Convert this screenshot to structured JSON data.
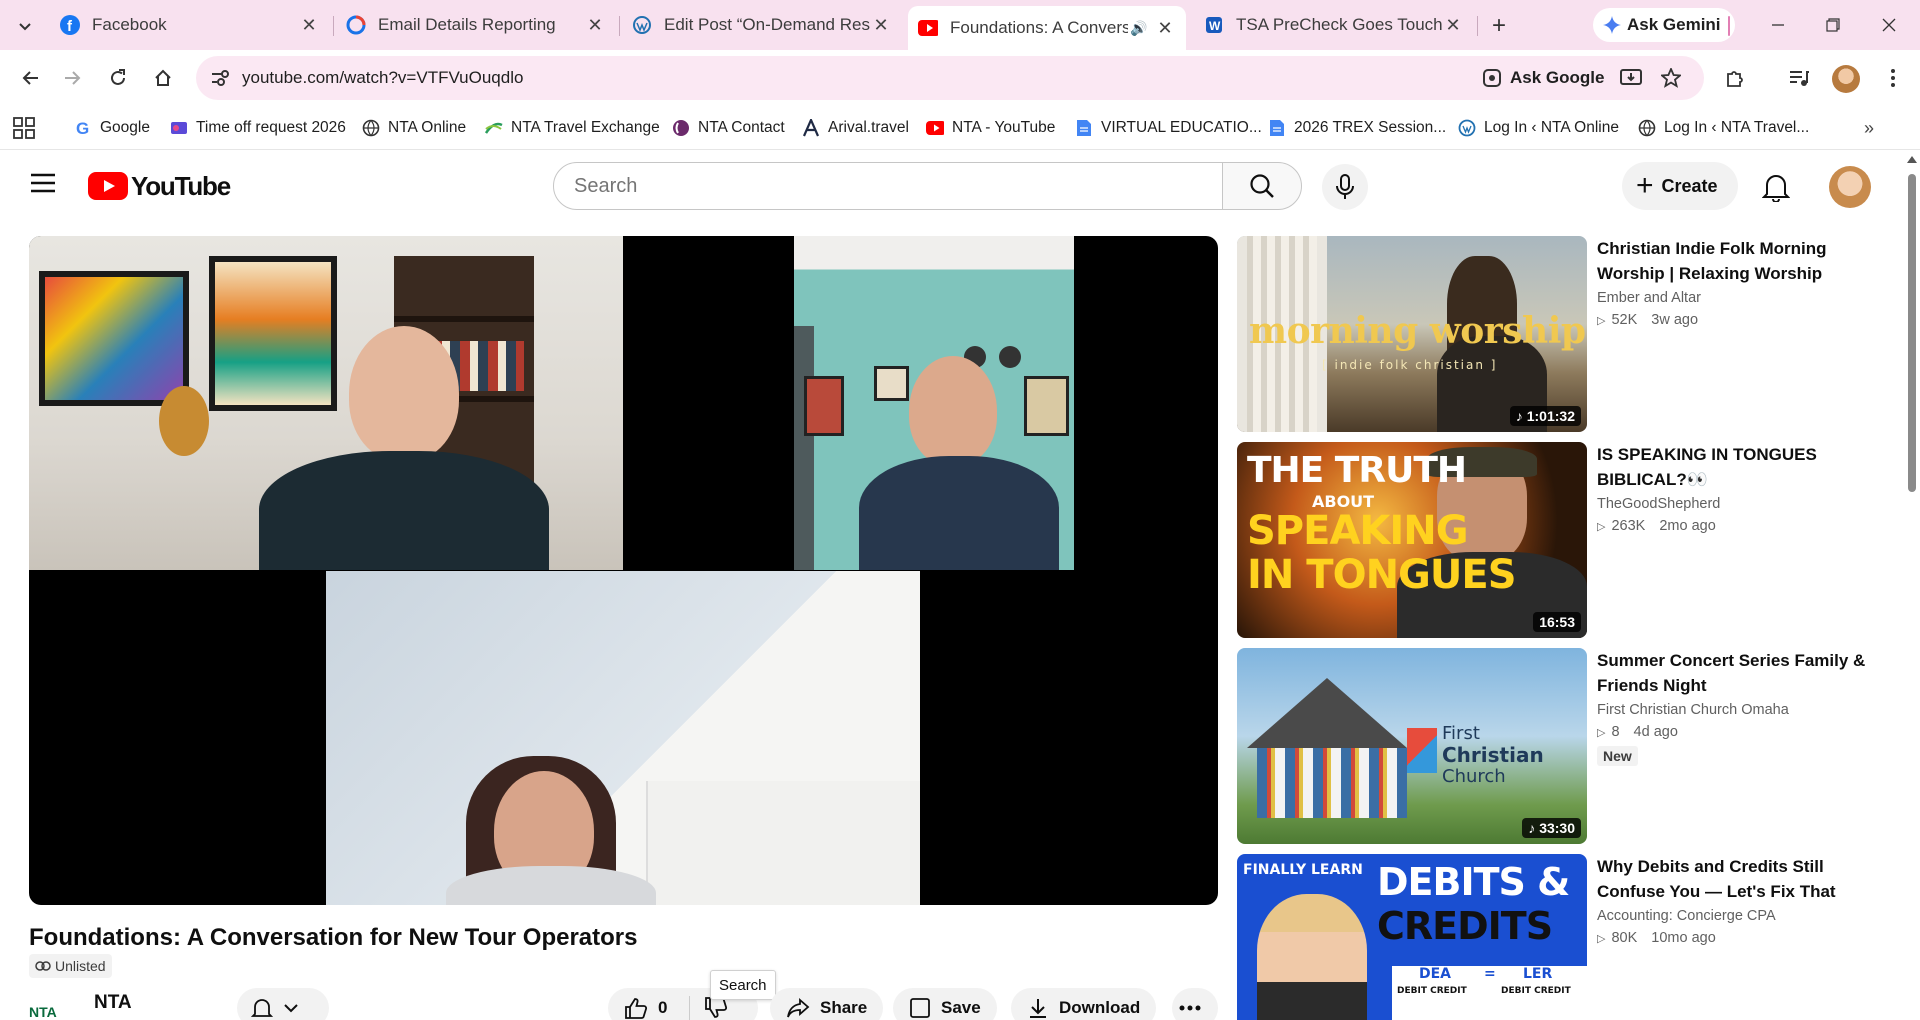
{
  "browser": {
    "tabs": [
      {
        "title": "Facebook",
        "icon": "facebook-icon"
      },
      {
        "title": "Email Details Reporting",
        "icon": "reporting-icon"
      },
      {
        "title": "Edit Post “On-Demand Resour",
        "icon": "wordpress-icon"
      },
      {
        "title": "Foundations: A Conversati",
        "icon": "youtube-icon",
        "active": true
      },
      {
        "title": "TSA PreCheck Goes Touchless",
        "icon": "word-icon"
      }
    ],
    "gemini_label": "Ask Gemini",
    "url": "youtube.com/watch?v=VTFVuOuqdlo",
    "ask_google_label": "Ask Google",
    "bookmarks": [
      {
        "label": "Google",
        "icon": "google-icon"
      },
      {
        "label": "Time off request 2026",
        "icon": "form-icon"
      },
      {
        "label": "NTA Online",
        "icon": "globe-icon"
      },
      {
        "label": "NTA Travel Exchange",
        "icon": "exchange-icon"
      },
      {
        "label": "NTA Contact",
        "icon": "contact-icon"
      },
      {
        "label": "Arival.travel",
        "icon": "arival-icon"
      },
      {
        "label": "NTA - YouTube",
        "icon": "youtube-icon"
      },
      {
        "label": "VIRTUAL EDUCATIO...",
        "icon": "doc-icon"
      },
      {
        "label": "2026 TREX Session...",
        "icon": "doc-icon"
      },
      {
        "label": "Log In ‹ NTA Online",
        "icon": "wordpress-icon"
      },
      {
        "label": "Log In ‹ NTA Travel...",
        "icon": "globe-icon"
      }
    ]
  },
  "youtube": {
    "logo_text": "YouTube",
    "search_placeholder": "Search",
    "create_label": "Create"
  },
  "video": {
    "title": "Foundations: A Conversation for New Tour Operators",
    "visibility": "Unlisted",
    "channel_name": "NTA",
    "channel_logo_text": "NTA",
    "likes": "0",
    "share_label": "Share",
    "save_label": "Save",
    "download_label": "Download",
    "tooltip": "Search"
  },
  "recommendations": [
    {
      "title": "Christian Indie Folk Morning Worship | Relaxing Worship Musi...",
      "channel": "Ember and Altar",
      "views": "52K",
      "age": "3w ago",
      "duration": "1:01:32",
      "thumb_text": "morning worship",
      "thumb_subtext": "[ indie folk christian ]"
    },
    {
      "title": "IS SPEAKING IN TONGUES BIBLICAL?👀",
      "channel": "TheGoodShepherd",
      "views": "263K",
      "age": "2mo ago",
      "duration": "16:53",
      "thumb_line1": "THE TRUTH",
      "thumb_line2": "ABOUT",
      "thumb_line3": "SPEAKING",
      "thumb_line4": "IN TONGUES"
    },
    {
      "title": "Summer Concert Series Family & Friends Night",
      "channel": "First Christian Church Omaha",
      "views": "8",
      "age": "4d ago",
      "badge": "New",
      "duration": "33:30",
      "thumb_line1": "First",
      "thumb_line2": "Christian",
      "thumb_line3": "Church"
    },
    {
      "title": "Why Debits and Credits Still Confuse You — Let's Fix That",
      "channel": "Accounting: Concierge CPA",
      "views": "80K",
      "age": "10mo ago",
      "thumb_line1": "FINALLY LEARN",
      "thumb_line2": "DEBITS &",
      "thumb_line3": "CREDITS",
      "thumb_t1": "DEA",
      "thumb_eq": "=",
      "thumb_t2": "LER",
      "thumb_col1": "DEBIT CREDIT",
      "thumb_col2": "DEBIT CREDIT"
    }
  ]
}
